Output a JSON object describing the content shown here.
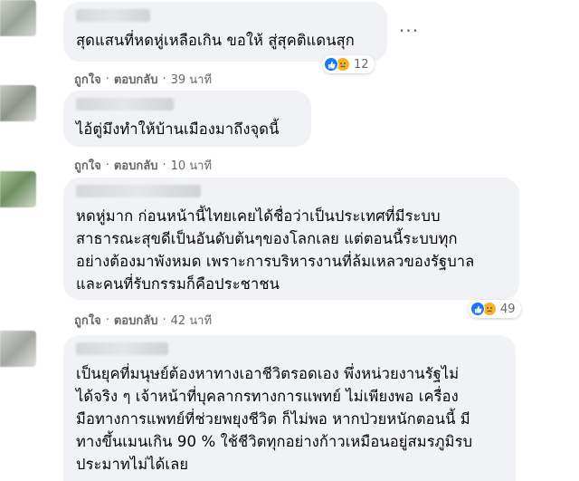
{
  "comments": [
    {
      "text": "สุดแสนที่หดหู่เหลือเกิน ขอให้ สู่สุคติแดนสุก",
      "like_label": "ถูกใจ",
      "reply_label": "ตอบกลับ",
      "time": "39 นาที",
      "reaction_count": "12"
    },
    {
      "text": "ไอ้ตู่มึงทำให้บ้านเมืองมาถึงจุดนี้",
      "like_label": "ถูกใจ",
      "reply_label": "ตอบกลับ",
      "time": "10 นาที"
    },
    {
      "text": "หดหู่มาก ก่อนหน้านี้ไทยเคยได้ชื่อว่าเป็นประเทศที่มีระบบ\nสาธารณะสุขดีเป็นอันดับต้นๆของโลกเลย แต่ตอนนี้ระบบทุก\nอย่างต้องมาพังหมด เพราะการบริหารงานที่ล้มเหลวของรัฐบาล\nและคนที่รับกรรมก็คือประชาชน",
      "like_label": "ถูกใจ",
      "reply_label": "ตอบกลับ",
      "time": "42 นาที",
      "reaction_count": "49"
    },
    {
      "text": "เป็นยุคที่มนุษย์ต้องหาทางเอาชีวิตรอดเอง พึ่งหน่วยงานรัฐไม่\nได้จริง ๆ เจ้าหน้าที่บุคลากรทางการแพทย์ ไม่เพียงพอ เครื่อง\nมือทางการแพทย์ที่ช่วยพยุงชีวิต ก็ไม่พอ หากป่วยหนักตอนนี้ มี\nทางขึ้นเมนเกิน 90 % ใช้ชีวิตทุกอย่างก้าวเหมือนอยู่สมรภูมิรบ\nประมาทไม่ได้เลย"
    }
  ],
  "more_options": "···",
  "separator": "·",
  "colors": {
    "bubble": "#f0f2f5",
    "meta": "#65676b",
    "like": "#1877f2",
    "sad": "#f7b125"
  }
}
